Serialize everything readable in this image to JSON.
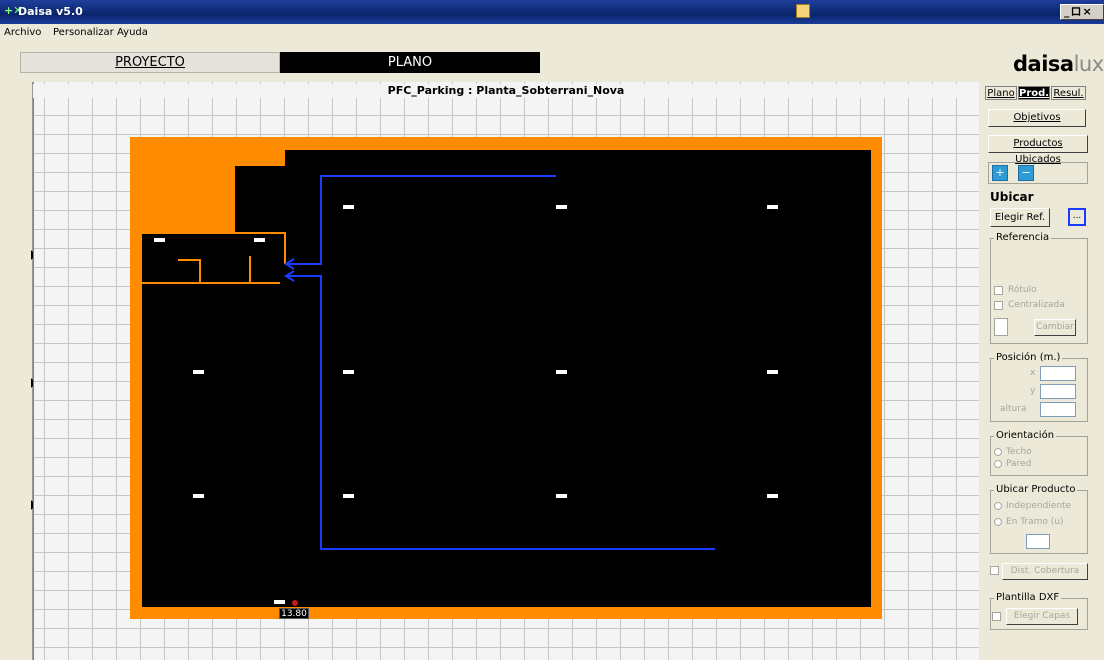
{
  "window": {
    "title": "Daisa v5.0",
    "controls": "_ロ×"
  },
  "menu": [
    "Archivo",
    "Personalizar",
    "Ayuda"
  ],
  "tabs": {
    "proyecto": "PROYECTO",
    "plano": "PLANO"
  },
  "logo": {
    "bold": "daisa",
    "light": "lux"
  },
  "plan": {
    "title": "PFC_Parking : Planta_Sobterrani_Nova",
    "dimension": "13.80"
  },
  "panel": {
    "tabs": [
      "Plano",
      "Prod.",
      "Resul."
    ],
    "objetivos": "Objetivos",
    "productos": "Productos Ubicados",
    "ubicar": "Ubicar",
    "elegir_ref": "Elegir Ref.",
    "browse": "...",
    "referencia": "Referencia",
    "rotulo": "Rótulo",
    "centralizada": "Centralizada",
    "cambiar": "Cambiar",
    "posicion": "Posición (m.)",
    "x": "x",
    "y": "y",
    "altura": "altura",
    "orientacion": "Orientación",
    "techo": "Techo",
    "pared": "Pared",
    "ubicar_producto": "Ubicar Producto",
    "independiente": "Independiente",
    "en_tramo": "En Tramo (u)",
    "dist_cobertura": "Dist. Cobertura",
    "plantilla": "Plantilla DXF",
    "elegir_capas": "Elegir Capas"
  }
}
